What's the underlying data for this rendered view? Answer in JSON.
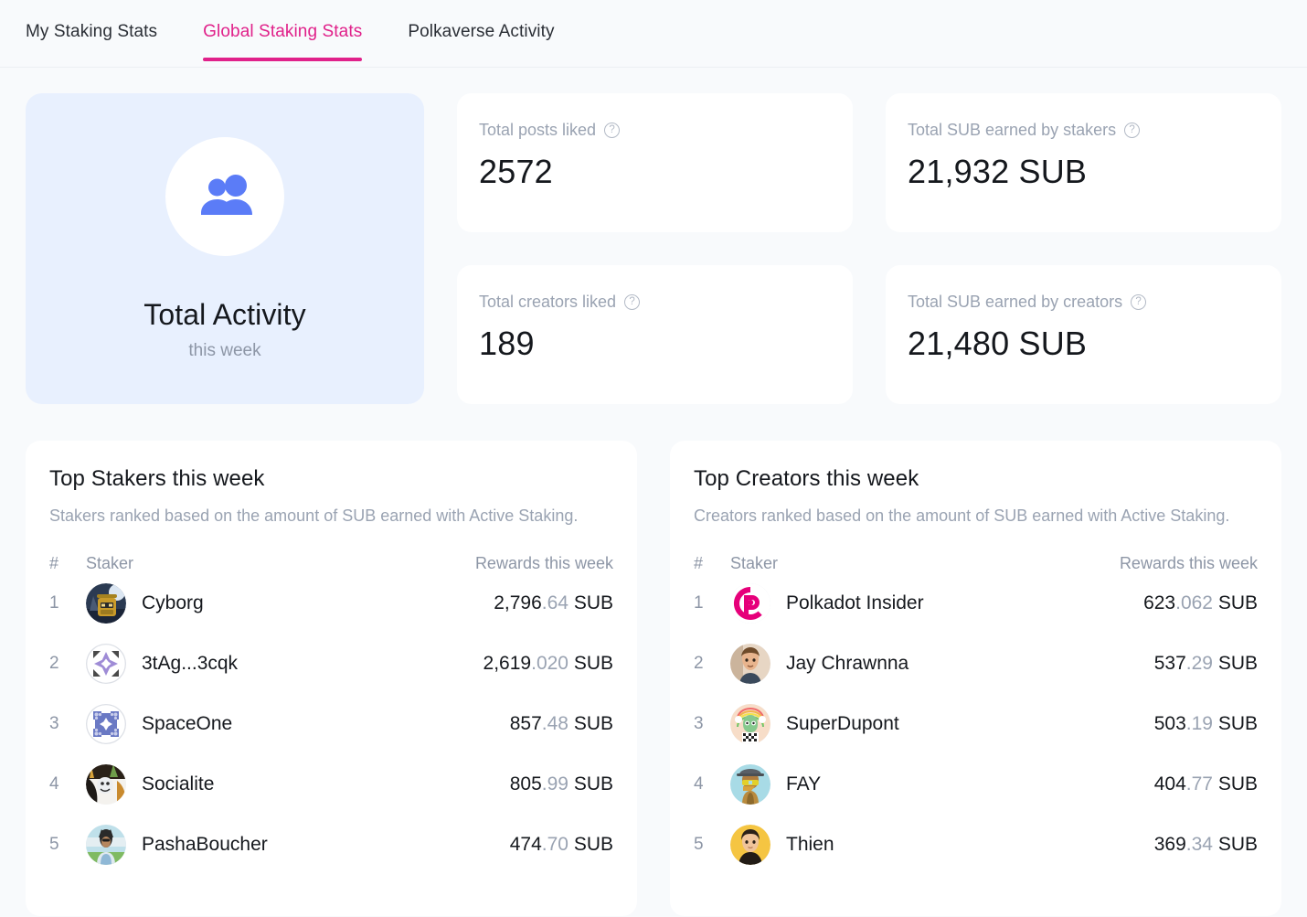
{
  "tabs": [
    {
      "label": "My Staking Stats",
      "active": false
    },
    {
      "label": "Global Staking Stats",
      "active": true
    },
    {
      "label": "Polkaverse Activity",
      "active": false
    }
  ],
  "colors": {
    "accent": "#e0218a",
    "page_bg": "#f8fafc",
    "activity_card_bg": "#e8f0fe",
    "people_icon": "#5b7cf7",
    "muted_text": "#9aa3b2"
  },
  "activity_card": {
    "icon": "people-icon",
    "title": "Total Activity",
    "subtitle": "this week"
  },
  "stats": [
    {
      "label": "Total posts liked",
      "value": "2572",
      "info_icon": "question-circle-icon"
    },
    {
      "label": "Total SUB earned by stakers",
      "value": "21,932 SUB",
      "info_icon": "question-circle-icon"
    },
    {
      "label": "Total creators liked",
      "value": "189",
      "info_icon": "question-circle-icon"
    },
    {
      "label": "Total SUB earned by creators",
      "value": "21,480 SUB",
      "info_icon": "question-circle-icon"
    }
  ],
  "boards": [
    {
      "title": "Top Stakers this week",
      "description": "Stakers ranked based on the amount of SUB earned with Active Staking.",
      "columns": {
        "rank": "#",
        "name": "Staker",
        "reward": "Rewards this week"
      },
      "rows": [
        {
          "rank": "1",
          "name": "Cyborg",
          "int": "2,796",
          "dec": ".64",
          "unit": " SUB",
          "avatar": "cyborg-avatar"
        },
        {
          "rank": "2",
          "name": "3tAg...3cqk",
          "int": "2,619",
          "dec": ".020",
          "unit": " SUB",
          "avatar": "identicon-purple-avatar"
        },
        {
          "rank": "3",
          "name": "SpaceOne",
          "int": "857",
          "dec": ".48",
          "unit": " SUB",
          "avatar": "identicon-blue-avatar"
        },
        {
          "rank": "4",
          "name": "Socialite",
          "int": "805",
          "dec": ".99",
          "unit": " SUB",
          "avatar": "socialite-avatar"
        },
        {
          "rank": "5",
          "name": "PashaBoucher",
          "int": "474",
          "dec": ".70",
          "unit": " SUB",
          "avatar": "pashaboucher-avatar"
        }
      ]
    },
    {
      "title": "Top Creators this week",
      "description": "Creators ranked based on the amount of SUB earned with Active Staking.",
      "columns": {
        "rank": "#",
        "name": "Staker",
        "reward": "Rewards this week"
      },
      "rows": [
        {
          "rank": "1",
          "name": "Polkadot Insider",
          "int": "623",
          "dec": ".062",
          "unit": " SUB",
          "avatar": "polkadot-insider-avatar"
        },
        {
          "rank": "2",
          "name": "Jay Chrawnna",
          "int": "537",
          "dec": ".29",
          "unit": " SUB",
          "avatar": "jay-chrawnna-avatar"
        },
        {
          "rank": "3",
          "name": "SuperDupont",
          "int": "503",
          "dec": ".19",
          "unit": " SUB",
          "avatar": "superdupont-avatar"
        },
        {
          "rank": "4",
          "name": "FAY",
          "int": "404",
          "dec": ".77",
          "unit": " SUB",
          "avatar": "fay-avatar"
        },
        {
          "rank": "5",
          "name": "Thien",
          "int": "369",
          "dec": ".34",
          "unit": " SUB",
          "avatar": "thien-avatar"
        }
      ]
    }
  ]
}
